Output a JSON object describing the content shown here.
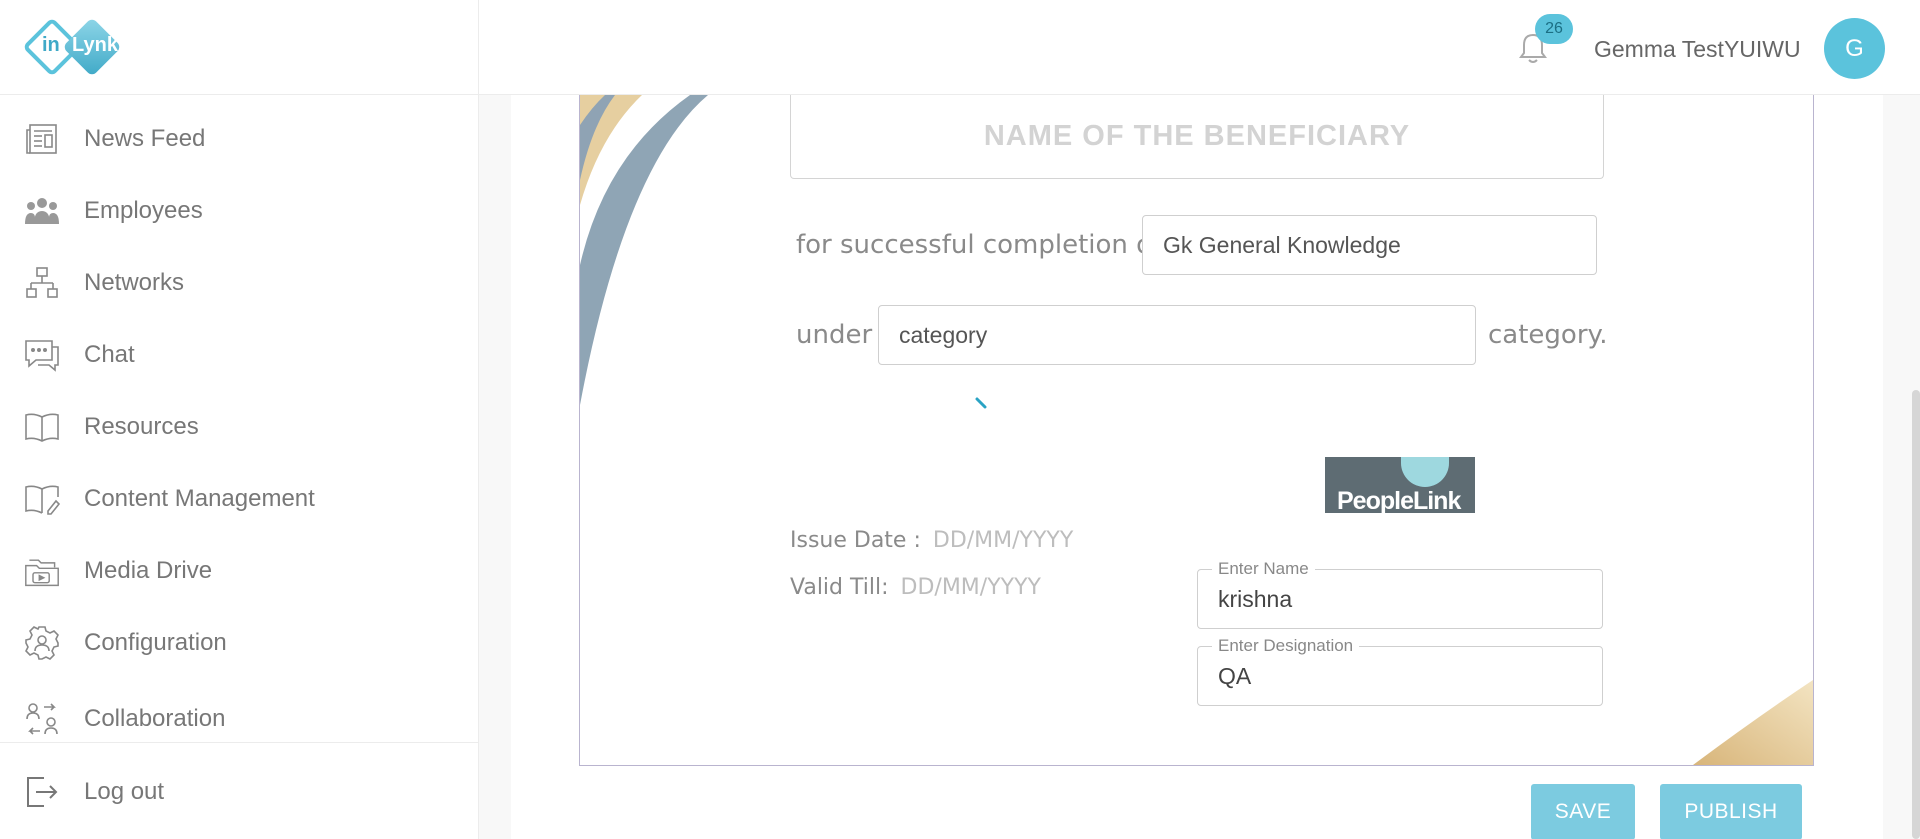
{
  "brand": {
    "logo_left": "in",
    "logo_right": "Lynk"
  },
  "sidebar": {
    "items": [
      {
        "label": "News Feed",
        "icon": "newspaper-icon"
      },
      {
        "label": "Employees",
        "icon": "people-icon"
      },
      {
        "label": "Networks",
        "icon": "network-icon"
      },
      {
        "label": "Chat",
        "icon": "chat-icon"
      },
      {
        "label": "Resources",
        "icon": "book-icon"
      },
      {
        "label": "Content Management",
        "icon": "edit-book-icon"
      },
      {
        "label": "Media Drive",
        "icon": "folder-media-icon"
      },
      {
        "label": "Configuration",
        "icon": "gear-user-icon"
      },
      {
        "label": "Collaboration",
        "icon": "collaboration-icon"
      }
    ],
    "logout": {
      "label": "Log out",
      "icon": "logout-icon"
    }
  },
  "header": {
    "notification_count": "26",
    "user_name": "Gemma TestYUIWU",
    "avatar_initial": "G"
  },
  "certificate": {
    "beneficiary_placeholder": "NAME OF THE BENEFICIARY",
    "completion_prefix": "for successful completion of",
    "course_value": "Gk General Knowledge",
    "under_label": "under",
    "category_value": "category",
    "category_suffix": "category.",
    "sponsor_logo_text": "PeopleLink",
    "issue_date_label": "Issue Date :",
    "issue_date_placeholder": "DD/MM/YYYY",
    "valid_till_label": "Valid Till:",
    "valid_till_placeholder": "DD/MM/YYYY",
    "name_field": {
      "label": "Enter Name",
      "value": "krishna"
    },
    "designation_field": {
      "label": "Enter Designation",
      "value": "QA"
    }
  },
  "actions": {
    "save": "SAVE",
    "publish": "PUBLISH"
  },
  "colors": {
    "accent": "#5bc3dc",
    "button": "#7ccbe0",
    "swoosh_gold": "#e6cfa0",
    "swoosh_slate": "#8a9db0"
  }
}
